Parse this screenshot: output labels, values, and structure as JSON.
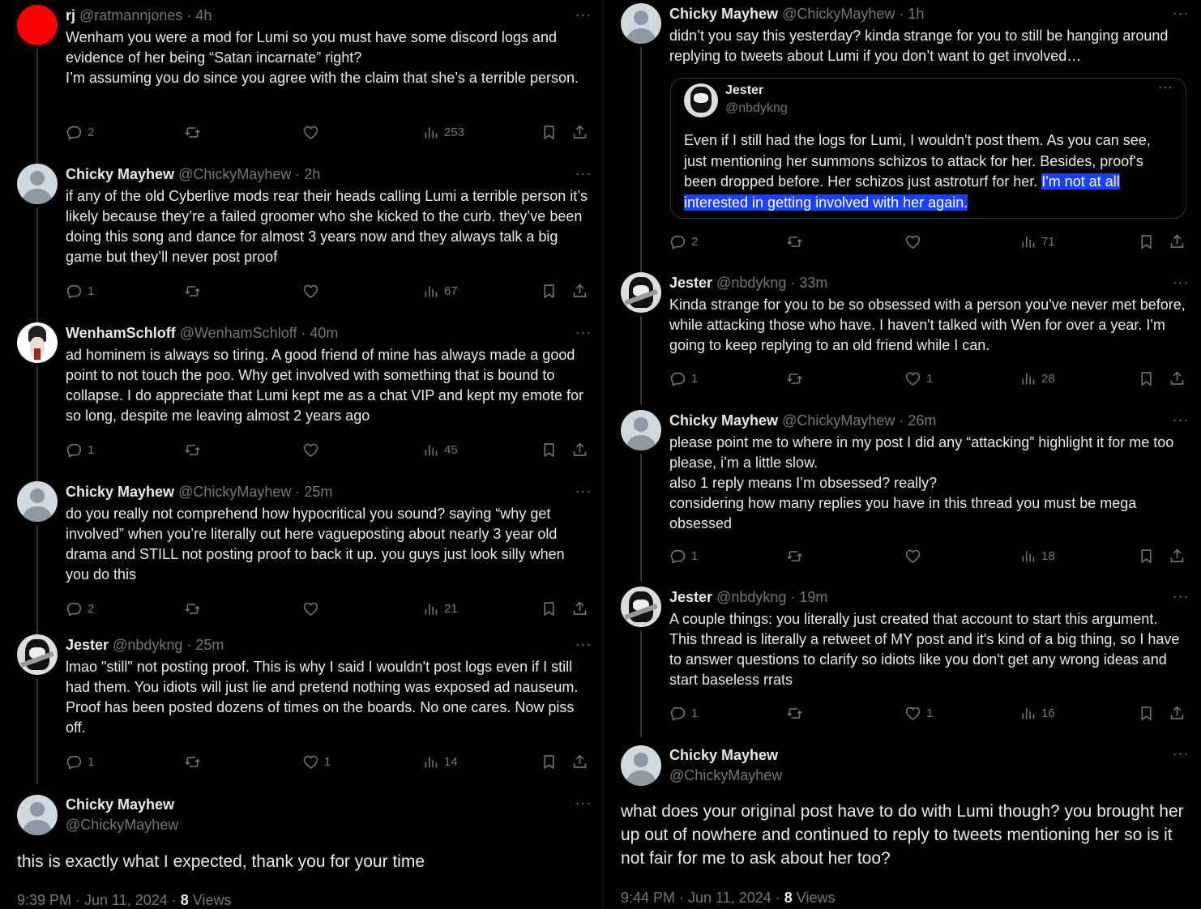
{
  "left_column": {
    "tweets": [
      {
        "avatar": "red-circle",
        "name": "rj",
        "handle": "@ratmannjones",
        "time": "4h",
        "text": "Wenham you were a mod for Lumi so you must have some discord logs and evidence of her being “Satan incarnate” right?\nI’m assuming you do since you agree with the claim that she’s a terrible person.",
        "replies": "2",
        "likes": "",
        "views": "253"
      },
      {
        "avatar": "default-avatar",
        "name": "Chicky Mayhew",
        "handle": "@ChickyMayhew",
        "time": "2h",
        "text": "if any of the old Cyberlive mods rear their heads calling Lumi a terrible person it’s likely because they’re a failed groomer who she kicked to the curb. they’ve been doing this song and dance for almost 3 years now and they always talk a big game but they’ll never post proof",
        "replies": "1",
        "likes": "",
        "views": "67"
      },
      {
        "avatar": "wenham-avatar",
        "name": "WenhamSchloff",
        "handle": "@WenhamSchloff",
        "time": "40m",
        "text": "ad hominem is always so tiring. A good friend of mine has always made a good point to not touch the poo. Why get involved with something that is bound to collapse. I do appreciate that Lumi kept me as a chat VIP and kept my emote for so long, despite me leaving almost 2 years ago",
        "replies": "1",
        "likes": "",
        "views": "45"
      },
      {
        "avatar": "default-avatar",
        "name": "Chicky Mayhew",
        "handle": "@ChickyMayhew",
        "time": "25m",
        "text": "do you really not comprehend how hypocritical you sound? saying “why get involved” when you’re literally out here vagueposting about nearly 3 year old drama and STILL not posting proof to back it up. you guys just look silly when you do this",
        "replies": "2",
        "likes": "",
        "views": "21"
      },
      {
        "avatar": "jester-avatar",
        "name": "Jester",
        "handle": "@nbdykng",
        "time": "25m",
        "text": "lmao \"still\" not posting proof. This is why I said I wouldn't post logs even if I still had them. You idiots will just lie and pretend nothing was exposed ad nauseum. Proof has been posted dozens of times on the boards. No one cares. Now piss off.",
        "replies": "1",
        "likes": "1",
        "views": "14"
      }
    ],
    "focal": {
      "name": "Chicky Mayhew",
      "handle": "@ChickyMayhew",
      "text": "this is exactly what I expected, thank you for your time",
      "timestamp": "9:39 PM · Jun 11, 2024 · ",
      "views_count": "8",
      "views_label": " Views"
    }
  },
  "right_column": {
    "tweets": [
      {
        "avatar": "default-avatar",
        "name": "Chicky Mayhew",
        "handle": "@ChickyMayhew",
        "time": "1h",
        "text": "didn’t you say this yesterday? kinda strange for you to still be hanging around replying to tweets about Lumi if you don’t want to get involved…",
        "replies": "2",
        "likes": "",
        "views": "71"
      },
      {
        "avatar": "jester-avatar",
        "name": "Jester",
        "handle": "@nbdykng",
        "time": "33m",
        "text": "Kinda strange for you to be so obsessed with a person you've never met before, while attacking those who have. I haven't talked with Wen for over a year. I'm going to keep replying to an old friend while I can.",
        "replies": "1",
        "likes": "1",
        "views": "28"
      },
      {
        "avatar": "default-avatar",
        "name": "Chicky Mayhew",
        "handle": "@ChickyMayhew",
        "time": "26m",
        "text": "please point me to where in my post I did any “attacking” highlight it for me too please, i’m a little slow.\nalso 1 reply means I’m obsessed? really?\nconsidering how many replies you have in this thread you must be mega obsessed",
        "replies": "1",
        "likes": "",
        "views": "18"
      },
      {
        "avatar": "jester-avatar",
        "name": "Jester",
        "handle": "@nbdykng",
        "time": "19m",
        "text": "A couple things: you literally just created that account to start this argument. This thread is literally a retweet of MY post and it's kind of a big thing, so I have to answer questions to clarify so idiots like you don't get any wrong ideas and start baseless rrats",
        "replies": "1",
        "likes": "1",
        "views": "16"
      }
    ],
    "quote": {
      "name": "Jester",
      "handle": "@nbdykng",
      "text_plain": "Even if I still had the logs for Lumi, I wouldn't post them. As you can see, just mentioning her summons schizos to attack for her. Besides, proof's been dropped before. Her schizos just astroturf for her. ",
      "text_highlight_1": "I'm not at all",
      "text_highlight_2": "interested in getting involved with her again."
    },
    "focal": {
      "name": "Chicky Mayhew",
      "handle": "@ChickyMayhew",
      "text": "what does your original post have to do with Lumi though? you brought her up out of nowhere and continued to reply to tweets mentioning her so is it not fair for me to ask about her too?",
      "timestamp": "9:44 PM · Jun 11, 2024 · ",
      "views_count": "8",
      "views_label": " Views"
    }
  },
  "ui": {
    "more_glyph": "···",
    "separator": " · "
  }
}
